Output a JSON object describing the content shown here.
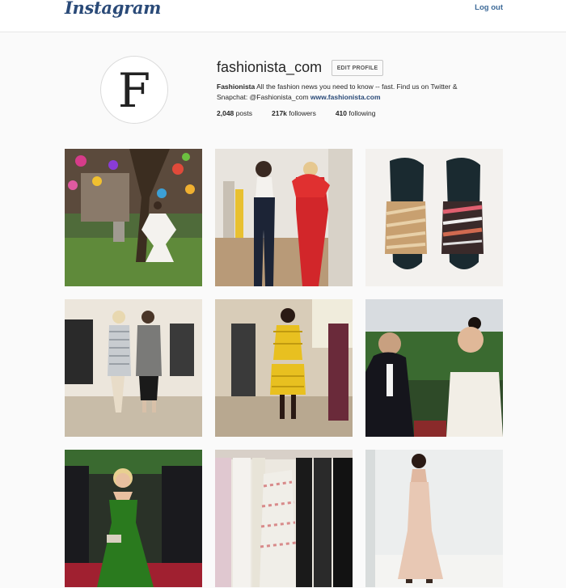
{
  "header": {
    "logo": "Instagram",
    "logout": "Log out"
  },
  "profile": {
    "avatar_letter": "F",
    "username": "fashionista_com",
    "edit_button": "EDIT PROFILE",
    "bio_name": "Fashionista",
    "bio_text": "All the fashion news you need to know -- fast. Find us on Twitter & Snapchat:",
    "bio_handle": "@Fashionista_com",
    "bio_link": "www.fashionista.com",
    "stats": {
      "posts_count": "2,048",
      "posts_label": "posts",
      "followers_count": "217k",
      "followers_label": "followers",
      "following_count": "410",
      "following_label": "following"
    }
  },
  "posts": [
    {
      "icon": "photo-garden-white-dress"
    },
    {
      "icon": "photo-runway-red-ruffle-dress"
    },
    {
      "icon": "photo-metallic-sandals"
    },
    {
      "icon": "photo-two-models-showroom"
    },
    {
      "icon": "photo-yellow-lace-dress"
    },
    {
      "icon": "photo-red-carpet-interview"
    },
    {
      "icon": "photo-green-strapless-gown"
    },
    {
      "icon": "photo-clothing-rack"
    },
    {
      "icon": "photo-slip-dress-studio"
    }
  ]
}
